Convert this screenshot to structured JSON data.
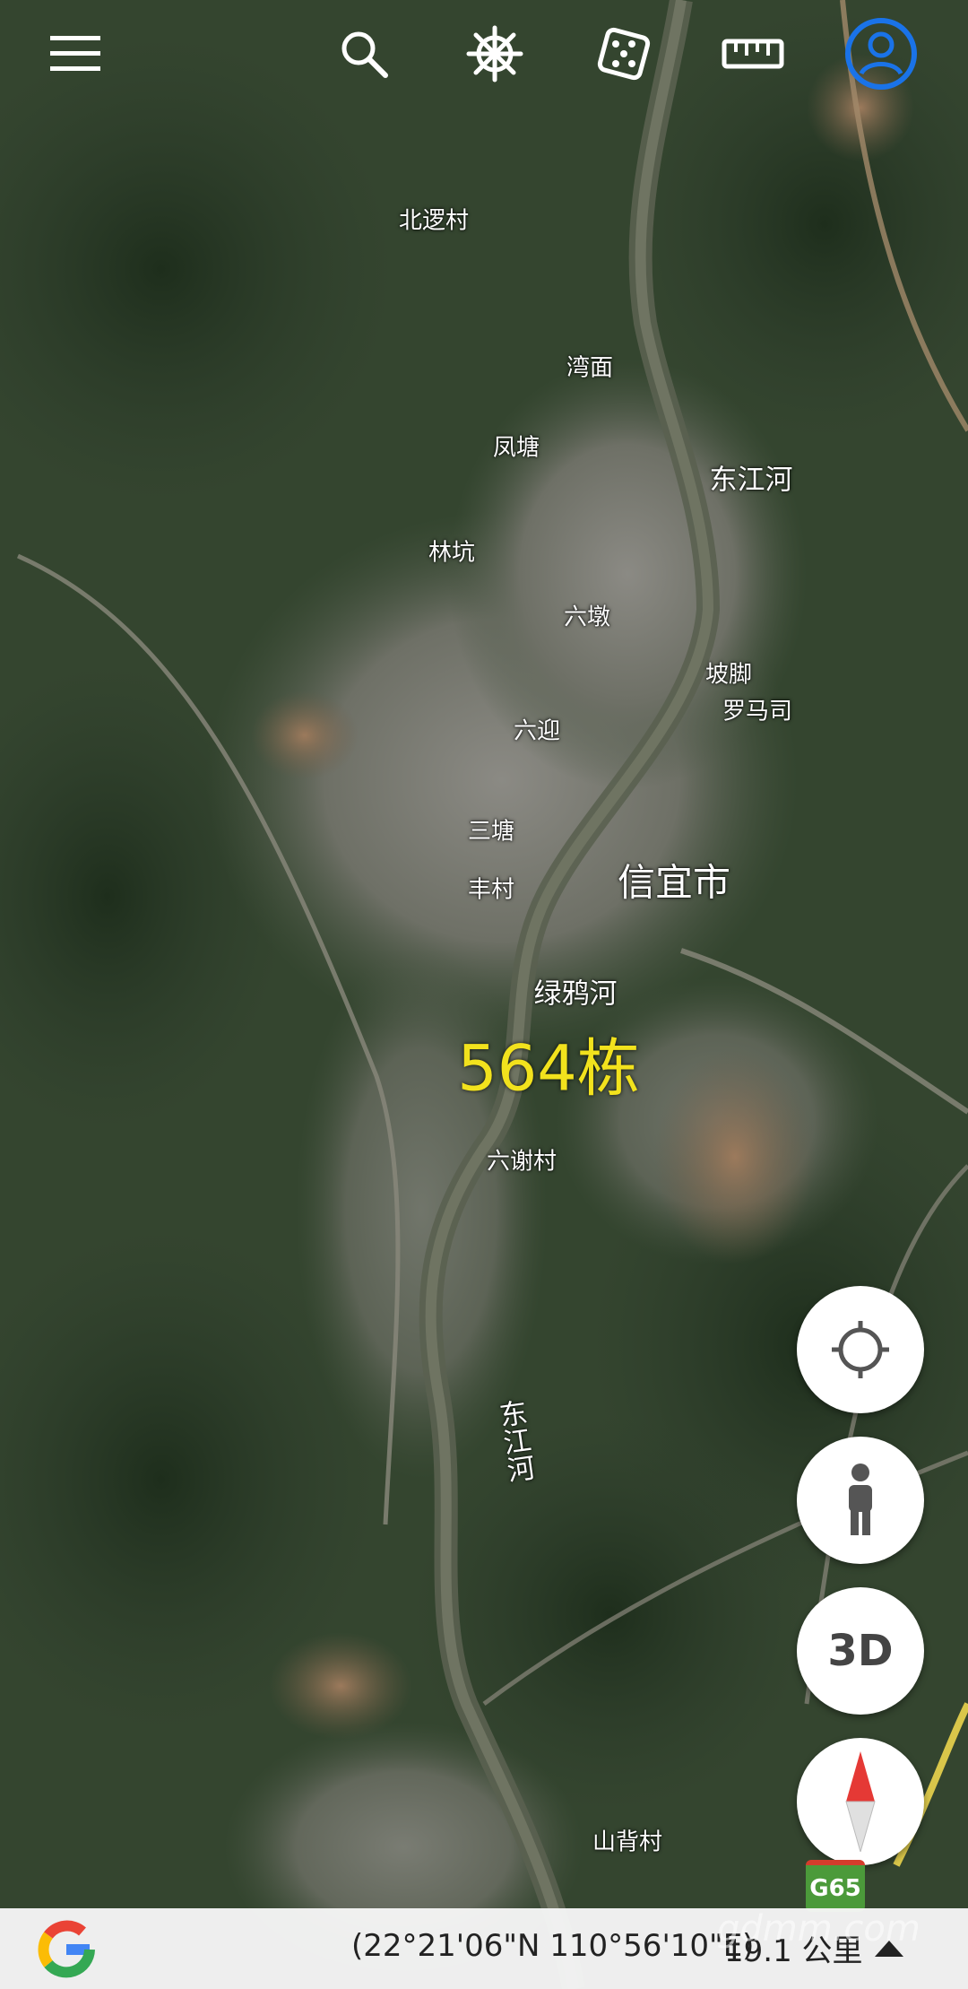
{
  "toolbar": {
    "buttons": [
      {
        "name": "menu-icon"
      },
      {
        "name": "search-icon"
      },
      {
        "name": "voyager-wheel-icon"
      },
      {
        "name": "dice-icon"
      },
      {
        "name": "ruler-icon"
      },
      {
        "name": "account-icon",
        "color": "#1a73e8"
      }
    ]
  },
  "places": {
    "beiyi": "北逻村",
    "wanmian": "湾面",
    "fengtang": "凤塘",
    "dongjianghe_north": "东江河",
    "linkeng": "林坑",
    "liudun": "六墩",
    "pojiao": "坡脚",
    "luomasi": "罗马司",
    "liuying": "六迎",
    "santang": "三塘",
    "xinyi": "信宜市",
    "fengcun": "丰村",
    "lvyahe": "绿鸦河",
    "building_count": "564栋",
    "liuxiecun": "六谢村",
    "dongjianghe_south": "东江河",
    "shanbeicun": "山背村"
  },
  "fabs": {
    "locate": {
      "icon": "crosshair-icon"
    },
    "street_view": {
      "icon": "pegman-icon"
    },
    "three_d": {
      "label": "3D"
    },
    "compass": {
      "icon": "compass-icon"
    }
  },
  "road_shield": "G65",
  "bottom_bar": {
    "logo": "google-g-logo",
    "coordinates": "(22°21'06\"N 110°56'10\"E)",
    "scale_label": "19.1 公里",
    "watermark": "gdmm.com"
  },
  "colors": {
    "highlight": "#f2e21d",
    "accent": "#1a73e8",
    "shield_green": "#4b9a3a"
  }
}
